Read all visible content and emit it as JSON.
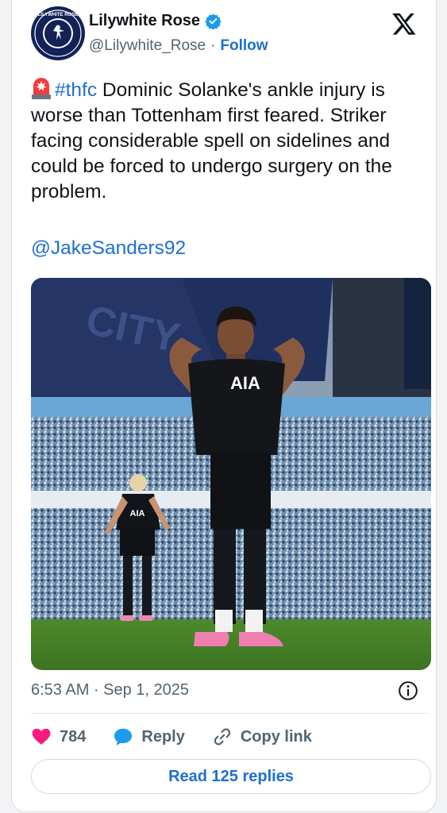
{
  "author": {
    "display_name": "Lilywhite Rose",
    "handle": "@Lilywhite_Rose",
    "separator": "·",
    "follow_label": "Follow",
    "avatar_text": "LILYWHITE ROSE"
  },
  "tweet": {
    "hashtag": "#thfc",
    "body": " Dominic Solanke's ankle injury is worse than Tottenham first feared. Striker facing considerable spell on sidelines and could be forced to undergo surgery on the problem.",
    "mention": "@JakeSanders92",
    "timestamp": "6:53 AM · Sep 1, 2025"
  },
  "photo": {
    "shirt_text": "AIA",
    "background_shirt_text": "AIA"
  },
  "actions": {
    "likes": "784",
    "reply_label": "Reply",
    "copy_label": "Copy link",
    "read_replies_label": "Read 125 replies"
  },
  "colors": {
    "accent": "#1d6fd1",
    "like": "#f91880",
    "reply_bubble": "#1d9bf0"
  },
  "icons": [
    "verified-badge-icon",
    "x-logo-icon",
    "siren-icon",
    "info-icon",
    "heart-icon",
    "reply-bubble-icon",
    "link-icon"
  ]
}
